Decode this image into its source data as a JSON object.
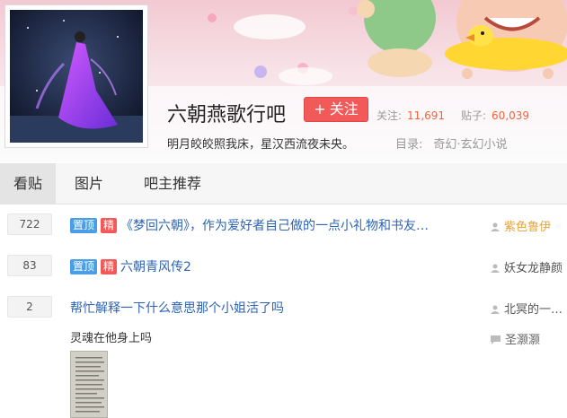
{
  "forum": {
    "name": "六朝燕歌行吧",
    "follow_label": "关注",
    "follow_plus": "+",
    "followers_label": "关注:",
    "followers_count": "11,691",
    "posts_label": "贴子:",
    "posts_count": "60,039",
    "slogan": "明月皎皎照我床，星汉西流夜未央。",
    "catalog_label": "目录:",
    "catalog_value": "奇幻·玄幻小说"
  },
  "tabs": [
    {
      "label": "看贴",
      "active": true
    },
    {
      "label": "图片",
      "active": false
    },
    {
      "label": "吧主推荐",
      "active": false
    }
  ],
  "badges": {
    "top": "置顶",
    "good": "精"
  },
  "threads": [
    {
      "replies": "722",
      "title": "《梦回六朝》，作为爱好者自己做的一点小礼物和书友…",
      "author": "紫色鲁伊",
      "author_color": "#e8a33a"
    },
    {
      "replies": "83",
      "title": "六朝青风传2",
      "author": "妖女龙静颜",
      "author_color": "#555555"
    },
    {
      "replies": "2",
      "title": "帮忙解释一下什么意思那个小姐活了吗",
      "author": "北冥的一…",
      "author_color": "#555555",
      "excerpt": "灵魂在他身上吗",
      "last_reply": "圣灏灏"
    }
  ],
  "colors": {
    "follow_button": "#f25a5a",
    "badge_top": "#4a9ee6",
    "badge_good": "#f25a5a",
    "link": "#2d64b3"
  }
}
